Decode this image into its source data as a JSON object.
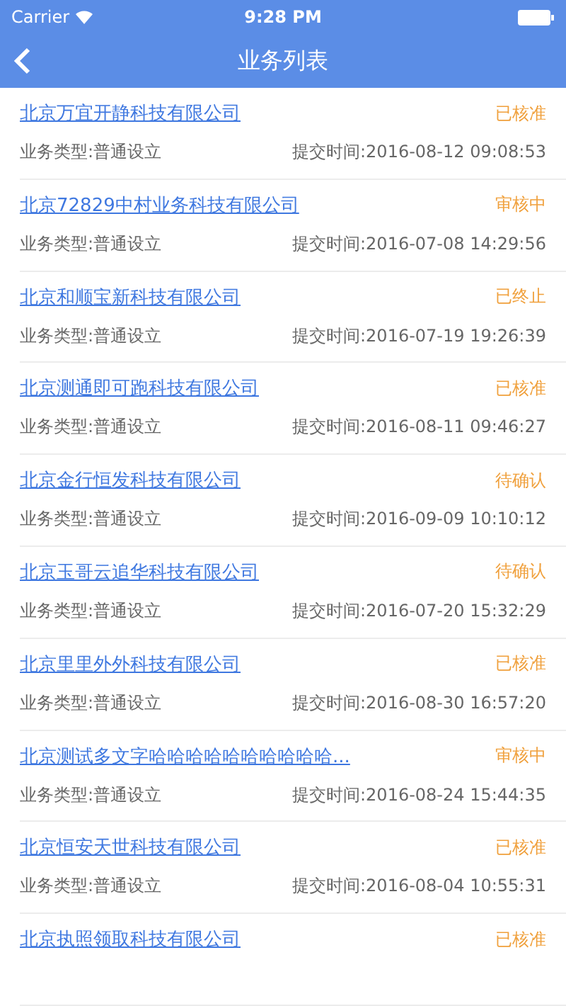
{
  "status_bar": {
    "carrier": "Carrier",
    "time": "9:28 PM"
  },
  "nav": {
    "title": "业务列表"
  },
  "items": [
    {
      "company": "北京万宜开静科技有限公司",
      "status": "已核准",
      "type": "业务类型:普通设立",
      "submitted": "提交时间:2016-08-12 09:08:53"
    },
    {
      "company": "北京72829中村业务科技有限公司",
      "status": "审核中",
      "type": "业务类型:普通设立",
      "submitted": "提交时间:2016-07-08 14:29:56"
    },
    {
      "company": "北京和顺宝新科技有限公司",
      "status": "已终止",
      "type": "业务类型:普通设立",
      "submitted": "提交时间:2016-07-19 19:26:39"
    },
    {
      "company": "北京测通即可跑科技有限公司",
      "status": "已核准",
      "type": "业务类型:普通设立",
      "submitted": "提交时间:2016-08-11 09:46:27"
    },
    {
      "company": "北京金行恒发科技有限公司",
      "status": "待确认",
      "type": "业务类型:普通设立",
      "submitted": "提交时间:2016-09-09 10:10:12"
    },
    {
      "company": "北京玉哥云追华科技有限公司",
      "status": "待确认",
      "type": "业务类型:普通设立",
      "submitted": "提交时间:2016-07-20 15:32:29"
    },
    {
      "company": "北京里里外外科技有限公司",
      "status": "已核准",
      "type": "业务类型:普通设立",
      "submitted": "提交时间:2016-08-30 16:57:20"
    },
    {
      "company": "北京测试多文字哈哈哈哈哈哈哈哈哈哈...",
      "status": "审核中",
      "type": "业务类型:普通设立",
      "submitted": "提交时间:2016-08-24 15:44:35"
    },
    {
      "company": "北京恒安天世科技有限公司",
      "status": "已核准",
      "type": "业务类型:普通设立",
      "submitted": "提交时间:2016-08-04 10:55:31"
    },
    {
      "company": "北京执照领取科技有限公司",
      "status": "已核准"
    }
  ]
}
